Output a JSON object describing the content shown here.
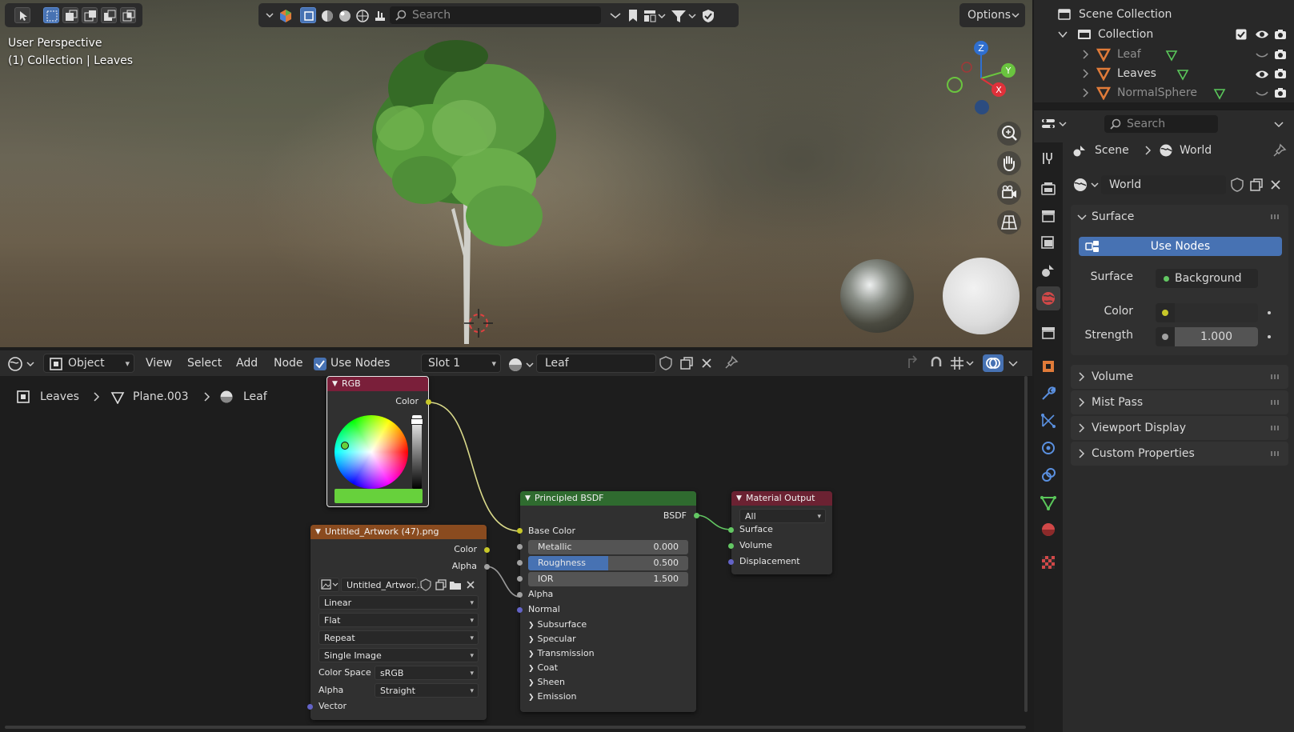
{
  "viewport": {
    "perspective_label": "User Perspective",
    "collection_label": "(1) Collection | Leaves",
    "search_placeholder": "Search",
    "options_label": "Options",
    "gizmo": {
      "z": "Z",
      "y": "Y",
      "x": "X"
    }
  },
  "outliner": {
    "root": "Scene Collection",
    "collection": "Collection",
    "items": [
      {
        "label": "Leaf",
        "dim": true
      },
      {
        "label": "Leaves",
        "dim": false
      },
      {
        "label": "NormalSphere",
        "dim": true
      }
    ]
  },
  "properties": {
    "search_placeholder": "Search",
    "breadcrumb_scene": "Scene",
    "breadcrumb_world": "World",
    "world_name": "World",
    "surface_panel": "Surface",
    "use_nodes_label": "Use Nodes",
    "surface_label": "Surface",
    "surface_value": "Background",
    "color_label": "Color",
    "strength_label": "Strength",
    "strength_value": "1.000",
    "panels": [
      "Volume",
      "Mist Pass",
      "Viewport Display",
      "Custom Properties"
    ]
  },
  "node_header": {
    "mode": "Object",
    "menus": [
      "View",
      "Select",
      "Add",
      "Node"
    ],
    "use_nodes": "Use Nodes",
    "slot": "Slot 1",
    "material": "Leaf"
  },
  "node_breadcrumb": {
    "object": "Leaves",
    "mesh": "Plane.003",
    "material": "Leaf"
  },
  "nodes": {
    "rgb": {
      "title": "RGB",
      "output": "Color",
      "color_hex": "#67d13c"
    },
    "image": {
      "title": "Untitled_Artwork (47).png",
      "out_color": "Color",
      "out_alpha": "Alpha",
      "image_name": "Untitled_Artwor...",
      "interpolation": "Linear",
      "projection": "Flat",
      "extension": "Repeat",
      "source": "Single Image",
      "colorspace_label": "Color Space",
      "colorspace_value": "sRGB",
      "alpha_label": "Alpha",
      "alpha_value": "Straight",
      "vector": "Vector"
    },
    "bsdf": {
      "title": "Principled BSDF",
      "output": "BSDF",
      "base_color": "Base Color",
      "metallic_label": "Metallic",
      "metallic_value": "0.000",
      "metallic_fill": 0,
      "roughness_label": "Roughness",
      "roughness_value": "0.500",
      "roughness_fill": 0.5,
      "ior_label": "IOR",
      "ior_value": "1.500",
      "alpha": "Alpha",
      "normal": "Normal",
      "subpanels": [
        "Subsurface",
        "Specular",
        "Transmission",
        "Coat",
        "Sheen",
        "Emission"
      ]
    },
    "output": {
      "title": "Material Output",
      "target": "All",
      "surface": "Surface",
      "volume": "Volume",
      "displacement": "Displacement"
    }
  },
  "colors": {
    "accent": "#4772b3",
    "rgb_header": "#7a1f3a",
    "image_header": "#8a4b1f",
    "shader_header": "#2f6b2f",
    "output_header": "#6b2232"
  }
}
